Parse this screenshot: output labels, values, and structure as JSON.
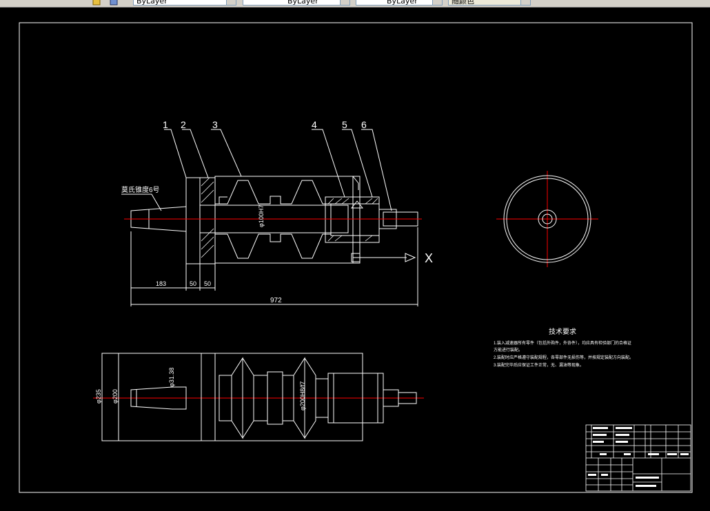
{
  "toolbar": {
    "linetype_value": "ByLayer",
    "lineweight_value": "ByLayer",
    "plotstyle_value": "ByLayer",
    "color_value": "随颜色"
  },
  "drawing": {
    "balloons": [
      "1",
      "2",
      "3",
      "4",
      "5",
      "6"
    ],
    "taper_label": "莫氏锥度6号",
    "bore_label": "φ100H7",
    "dim_183": "183",
    "dim_50a": "50",
    "dim_50b": "50",
    "dim_972": "972",
    "axis_x_label": "X",
    "dim_dia_235": "φ235",
    "dim_dia_200": "φ200",
    "dim_small": "φ31.38",
    "dim_fit": "φ200H8/f7"
  },
  "tech_requirements": {
    "title": "技术要求",
    "lines": [
      "1.装入减速器所有零件（包括外购件，外协件），均应具有检验部门的合格证",
      "  方能进行装配。",
      "2.装配时应严格遵守装配规程，各零部件无损伤等，并按规定装配方向装配。",
      "3.装配完毕后应保证工件正常，无、漏油等现象。"
    ]
  },
  "colors": {
    "background": "#000000",
    "line": "#ffffff",
    "centerline": "#ff0000",
    "toolbar": "#d4d0c8"
  }
}
